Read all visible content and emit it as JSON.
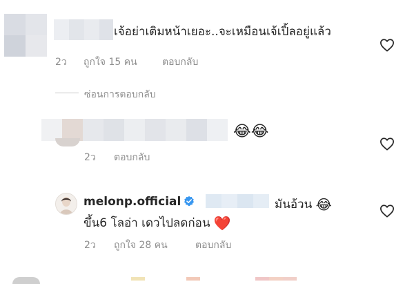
{
  "comments": [
    {
      "text": "เจ้อย่าเติมหน้าเยอะ..จะเหมือนเจ้เปิ้ลอยู่แล้ว",
      "time": "2ว",
      "likes": "ถูกใจ 15 คน",
      "reply": "ตอบกลับ"
    },
    {
      "emoji": "😂😂",
      "time": "2ว",
      "reply": "ตอบกลับ"
    },
    {
      "username": "melonp.official",
      "text_line1": "มันอ้วน",
      "emoji_line1": "😂",
      "text_line2": "ขึ้น6 โลอ่า เดวไปลดก่อน",
      "emoji_line2": "❤️",
      "time": "2ว",
      "likes": "ถูกใจ 28 คน",
      "reply": "ตอบกลับ"
    }
  ],
  "hide_replies": "ซ่อนการตอบกลับ",
  "icons": [
    "heart-outline-icon",
    "verified-badge-icon"
  ],
  "colors": {
    "text": "#262626",
    "meta": "#8e8e8e",
    "verified": "#3897f0",
    "heart": "#262626"
  }
}
